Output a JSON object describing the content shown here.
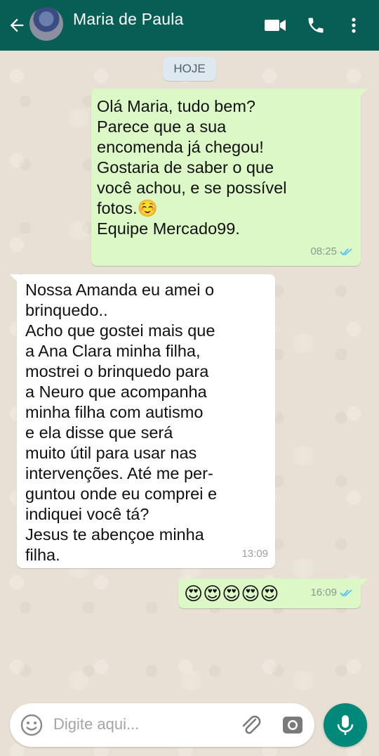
{
  "header": {
    "contact_name": "Maria de Paula",
    "back_icon": "arrow-left-icon",
    "video_icon": "video-call-icon",
    "call_icon": "phone-icon",
    "menu_icon": "more-vert-icon",
    "color": "#075e54"
  },
  "chat": {
    "date_chip": "HOJE",
    "messages": [
      {
        "direction": "outgoing",
        "text": "Olá Maria, tudo bem?\nParece que a sua\nencomenda já chegou!\nGostaria de saber o que\nvocê achou, e se possível\nfotos.☺️\nEquipe Mercado99.",
        "time": "08:25",
        "status": "read-double-check"
      },
      {
        "direction": "incoming",
        "text": "Nossa Amanda eu amei o\nbrinquedo..\nAcho que gostei mais que\na Ana Clara minha filha,\nmostrei o brinquedo para\na Neuro que acompanha\nminha filha com autismo\ne ela disse que será\nmuito útil para usar nas\nintervenções. Até me per-\nguntou onde eu comprei e\nindiquei você tá?\nJesus te abençoe minha\nfilha.",
        "time": "13:09"
      },
      {
        "direction": "outgoing",
        "text": "😍😍😍😍😍",
        "emoji_count": 5,
        "emoji_name": "heart-eyes-emoji",
        "time": "16:09",
        "status": "read-double-check"
      }
    ]
  },
  "composer": {
    "placeholder": "Digite aqui...",
    "emoji_icon": "emoji-icon",
    "attach_icon": "paperclip-icon",
    "camera_icon": "camera-icon",
    "mic_icon": "mic-icon",
    "mic_color": "#00897b"
  },
  "colors": {
    "outgoing_bubble": "#dcf8c6",
    "incoming_bubble": "#ffffff",
    "read_tick": "#4fc3f7"
  }
}
